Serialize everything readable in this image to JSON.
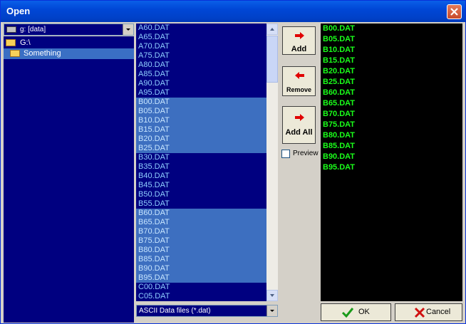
{
  "window": {
    "title": "Open"
  },
  "drive": {
    "label": "g: [data]"
  },
  "tree": {
    "items": [
      "G:\\",
      "Something"
    ]
  },
  "files": [
    "A60.DAT",
    "A65.DAT",
    "A70.DAT",
    "A75.DAT",
    "A80.DAT",
    "A85.DAT",
    "A90.DAT",
    "A95.DAT",
    "B00.DAT",
    "B05.DAT",
    "B10.DAT",
    "B15.DAT",
    "B20.DAT",
    "B25.DAT",
    "B30.DAT",
    "B35.DAT",
    "B40.DAT",
    "B45.DAT",
    "B50.DAT",
    "B55.DAT",
    "B60.DAT",
    "B65.DAT",
    "B70.DAT",
    "B75.DAT",
    "B80.DAT",
    "B85.DAT",
    "B90.DAT",
    "B95.DAT",
    "C00.DAT",
    "C05.DAT"
  ],
  "selected_files_in_list": [
    "B00.DAT",
    "B05.DAT",
    "B10.DAT",
    "B15.DAT",
    "B20.DAT",
    "B25.DAT",
    "B60.DAT",
    "B65.DAT",
    "B70.DAT",
    "B75.DAT",
    "B80.DAT",
    "B85.DAT",
    "B90.DAT",
    "B95.DAT"
  ],
  "filter": {
    "label": "ASCII Data files (*.dat)"
  },
  "actions": {
    "add": "Add",
    "remove": "Remove",
    "add_all": "Add All"
  },
  "preview": {
    "label": "Preview",
    "checked": false
  },
  "selected": [
    "B00.DAT",
    "B05.DAT",
    "B10.DAT",
    "B15.DAT",
    "B20.DAT",
    "B25.DAT",
    "B60.DAT",
    "B65.DAT",
    "B70.DAT",
    "B75.DAT",
    "B80.DAT",
    "B85.DAT",
    "B90.DAT",
    "B95.DAT"
  ],
  "buttons": {
    "ok": "OK",
    "cancel": "Cancel"
  },
  "colors": {
    "title_bar": "#0047d6",
    "list_bg": "#000080",
    "selected_bg": "#3d6fc0",
    "file_text": "#8fd0ff",
    "chosen_text": "#1aff1a"
  }
}
